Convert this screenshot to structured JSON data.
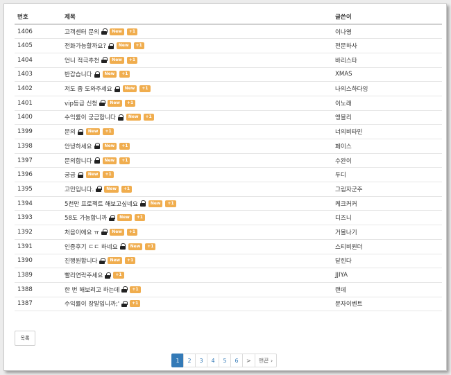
{
  "header": {
    "no": "번호",
    "title": "제목",
    "author": "글쓴이"
  },
  "badges": {
    "new": "New",
    "plus": "+1"
  },
  "rows": [
    {
      "no": "1406",
      "title": "고객센터 문의",
      "author": "이나영",
      "new": true
    },
    {
      "no": "1405",
      "title": "전화가능할까요?",
      "author": "전문하사",
      "new": true
    },
    {
      "no": "1404",
      "title": "언니 적극추천",
      "author": "바리스타",
      "new": true
    },
    {
      "no": "1403",
      "title": "반갑습니다",
      "author": "XMAS",
      "new": true
    },
    {
      "no": "1402",
      "title": "저도 좀 도와주세요",
      "author": "나의스하다잉",
      "new": true
    },
    {
      "no": "1401",
      "title": "vip등급 신청",
      "author": "이노래",
      "new": true
    },
    {
      "no": "1400",
      "title": "수익률이 궁금합니다",
      "author": "앵블리",
      "new": true
    },
    {
      "no": "1399",
      "title": "문의",
      "author": "너의비타민",
      "new": true
    },
    {
      "no": "1398",
      "title": "안녕하세요",
      "author": "페이스",
      "new": true
    },
    {
      "no": "1397",
      "title": "문의합니다",
      "author": "수완이",
      "new": true
    },
    {
      "no": "1396",
      "title": "궁금",
      "author": "두디",
      "new": true
    },
    {
      "no": "1395",
      "title": "고민입니다.",
      "author": "그림자군주",
      "new": true
    },
    {
      "no": "1394",
      "title": "5천만 프로젝트 해보고싶네요",
      "author": "케크커커",
      "new": true
    },
    {
      "no": "1393",
      "title": "58도 가능합니까",
      "author": "디즈니",
      "new": true
    },
    {
      "no": "1392",
      "title": "처음이에요 ㅠ",
      "author": "거몰나기",
      "new": true
    },
    {
      "no": "1391",
      "title": "인증후기 ㄷㄷ 하네요",
      "author": "스티비원더",
      "new": true
    },
    {
      "no": "1390",
      "title": "진행원합니다",
      "author": "닫힌다",
      "new": true
    },
    {
      "no": "1389",
      "title": "빨리연락주세요",
      "author": "JJIYA",
      "new": false
    },
    {
      "no": "1388",
      "title": "한 번 해보려고 하는데",
      "author": "랜데",
      "new": false
    },
    {
      "no": "1387",
      "title": "수익률이 창말입니까;'",
      "author": "문자이벤트",
      "new": false
    }
  ],
  "list_button": "목록",
  "pagination": {
    "pages": [
      "1",
      "2",
      "3",
      "4",
      "5",
      "6"
    ],
    "current": "1",
    "next": ">",
    "last": "맨끝 ›"
  }
}
